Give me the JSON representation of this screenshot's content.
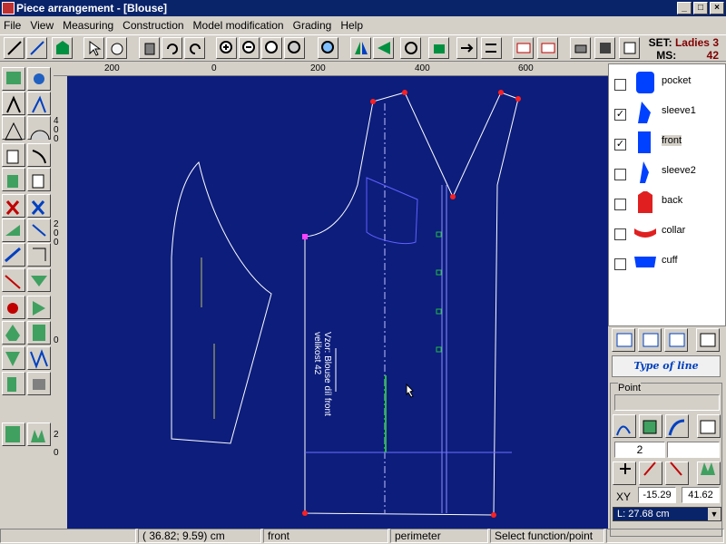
{
  "window": {
    "title": "Piece arrangement - [Blouse]"
  },
  "menu": [
    "File",
    "View",
    "Measuring",
    "Construction",
    "Model modification",
    "Grading",
    "Help"
  ],
  "setinfo": {
    "set_label": "SET:",
    "set_value": "Ladies 3",
    "ms_label": "MS:",
    "ms_value": "42"
  },
  "ruler": {
    "h_labels": [
      "200",
      "0",
      "200",
      "400",
      "600"
    ],
    "v_labels": [
      "4",
      "0",
      "0",
      "2",
      "0",
      "0",
      "0",
      "2",
      "0"
    ]
  },
  "pieces": [
    {
      "label": "pocket",
      "checked": false
    },
    {
      "label": "sleeve1",
      "checked": true
    },
    {
      "label": "front",
      "checked": true,
      "selected": true
    },
    {
      "label": "sleeve2",
      "checked": false
    },
    {
      "label": "back",
      "checked": false
    },
    {
      "label": "collar",
      "checked": false
    },
    {
      "label": "cuff",
      "checked": false
    }
  ],
  "canvas_text": {
    "l1": "Vzor: Blouse díl front",
    "l2": "velikost 42"
  },
  "type_of_line": "Type of line",
  "point": {
    "group_label": "Point",
    "number": "2",
    "xy_label": "XY",
    "x": "-15.29",
    "y": "41.62",
    "length": "L: 27.68 cm"
  },
  "status": {
    "coords": "( 36.82; 9.59) cm",
    "piece": "front",
    "mode": "perimeter",
    "hint": "Select function/point"
  },
  "colors": {
    "canvas": "#0c1d7c",
    "piece_icon": "#0040ff",
    "back_icon": "#e02020",
    "collar_icon": "#e02020"
  }
}
